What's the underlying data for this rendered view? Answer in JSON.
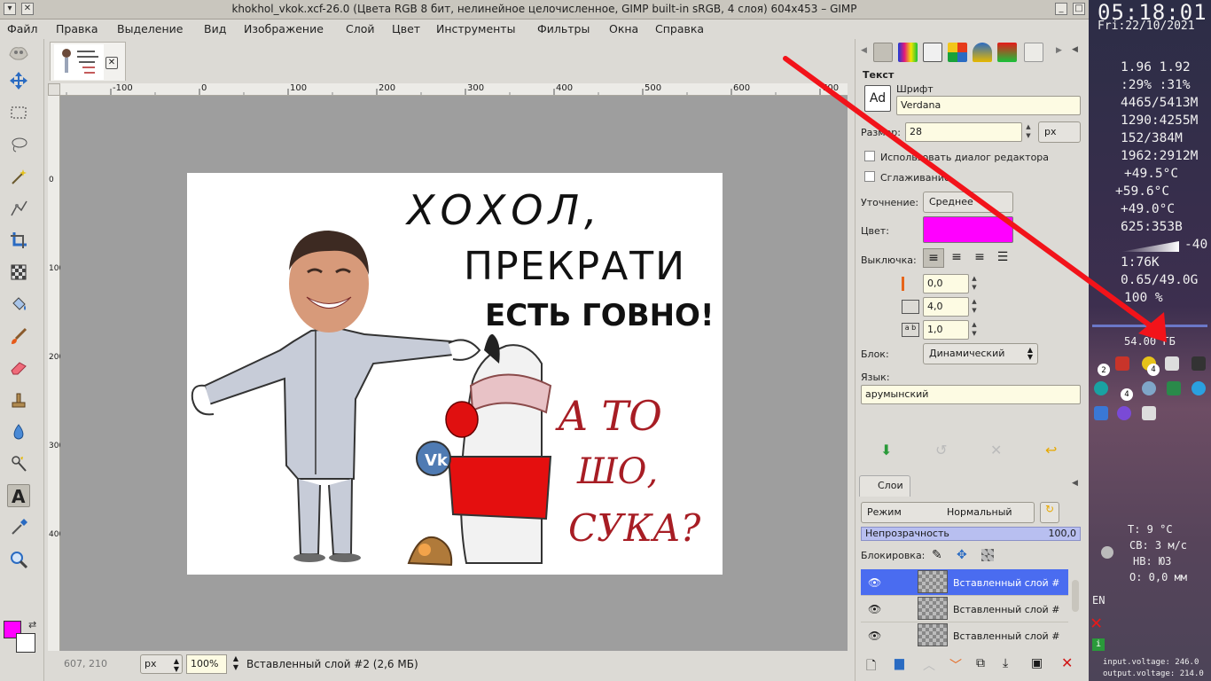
{
  "window": {
    "title": "khokhol_vkok.xcf-26.0 (Цвета RGB 8 бит, нелинейное целочисленное, GIMP built-in sRGB, 4 слоя) 604x453 – GIMP"
  },
  "menu": [
    "Файл",
    "Правка",
    "Выделение",
    "Вид",
    "Изображение",
    "Слой",
    "Цвет",
    "Инструменты",
    "Фильтры",
    "Окна",
    "Справка"
  ],
  "rulers": {
    "h_ticks": [
      "-100",
      "0",
      "100",
      "200",
      "300",
      "400",
      "500",
      "600",
      "700"
    ],
    "v_ticks": [
      "0",
      "100",
      "200",
      "300",
      "400"
    ]
  },
  "image_text": {
    "line1": "ХОХОЛ,",
    "line2": "ПРЕКРАТИ",
    "line3": "ЕСТЬ ГОВНО!",
    "line4": "А ТО",
    "line5": "ШО,",
    "line6": "СУКА?"
  },
  "statusbar": {
    "coords": "607, 210",
    "unit": "px",
    "zoom": "100%",
    "layer_info": "Вставленный слой #2 (2,6 МБ)"
  },
  "text_tool": {
    "header": "Текст",
    "font_label": "Шрифт",
    "font_value": "Verdana",
    "size_label": "Размер:",
    "size_value": "28",
    "size_unit": "px",
    "use_editor_label": "Использовать диалог редактора",
    "antialias_label": "Сглаживание",
    "hinting_label": "Уточнение:",
    "hinting_value": "Среднее",
    "color_label": "Цвет:",
    "color_value": "#ff00ff",
    "justify_label": "Выключка:",
    "indent_value": "0,0",
    "line_spacing_value": "4,0",
    "letter_spacing_value": "1,0",
    "box_label": "Блок:",
    "box_value": "Динамический",
    "language_label": "Язык:",
    "language_value": "арумынский"
  },
  "layers": {
    "tab_label": "Слои",
    "mode_label": "Режим",
    "mode_value": "Нормальный",
    "opacity_label": "Непрозрачность",
    "opacity_value": "100,0",
    "lock_label": "Блокировка:",
    "items": [
      {
        "name": "Вставленный слой #"
      },
      {
        "name": "Вставленный слой #"
      },
      {
        "name": "Вставленный слой #"
      }
    ]
  },
  "conky": {
    "time": "05:18:01",
    "date": "Fri:22/10/2021",
    "load": "1.96 1.92",
    "cpu": ":29% :31%",
    "mem1": "4465/5413M",
    "mem2": "1290:4255M",
    "mem3": "152/384M",
    "mem4": "1962:2912M",
    "temp1": "+49.5°C",
    "temp2": "+59.6°C",
    "temp3": "+49.0°C",
    "disk": "625:353B",
    "bar_value": "-40",
    "net": "1:76K",
    "traffic": "0.65/49.0G",
    "percent": "100 %",
    "disk_free": "54.00 ГБ",
    "weather_t": "T: 9 °C",
    "weather_wind": "СВ: 3 м/с",
    "weather_dir": "НВ: ЮЗ",
    "weather_rain": "О: 0,0 мм",
    "lang": "EN",
    "input_voltage": "input.voltage: 246.0",
    "output_voltage": "output.voltage: 214.0",
    "badge1": "2",
    "badge2": "4",
    "badge3": "4"
  }
}
